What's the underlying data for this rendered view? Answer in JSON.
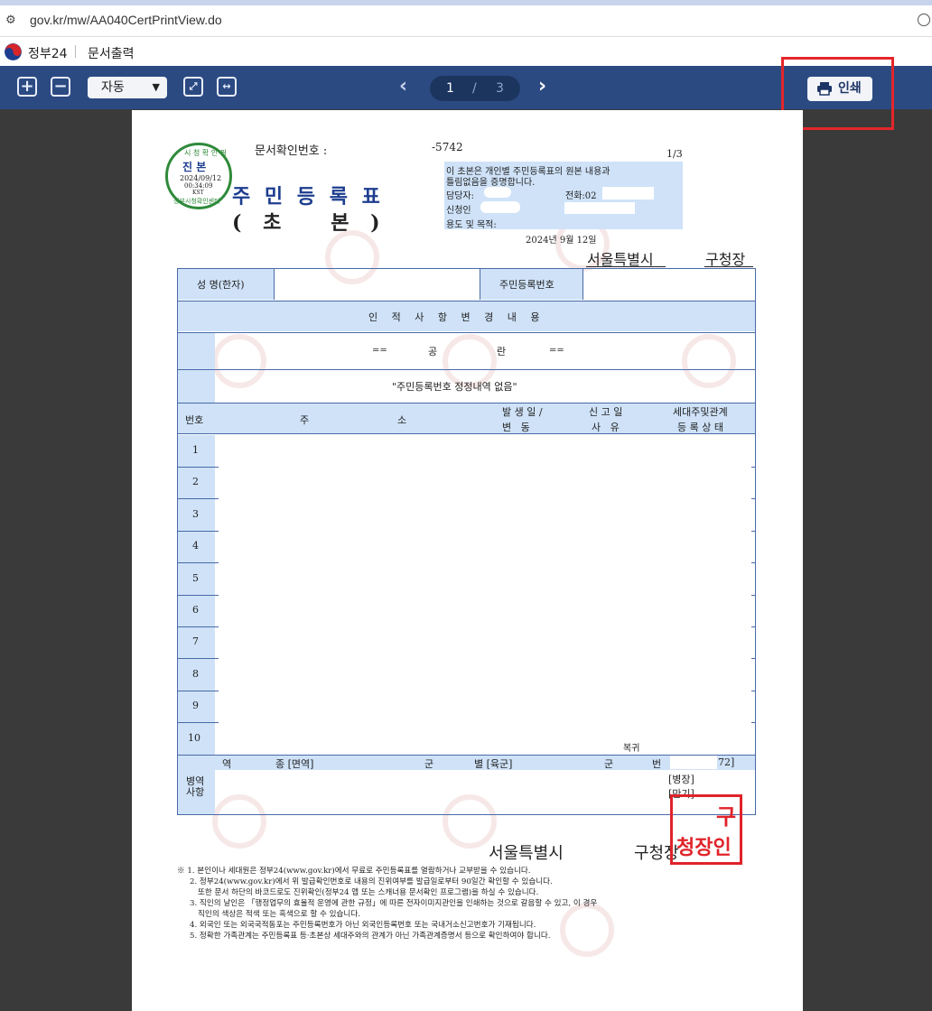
{
  "browser": {
    "url": "gov.kr/mw/AA040CertPrintView.do"
  },
  "app": {
    "brand": "정부24",
    "title": "문서출력"
  },
  "toolbar": {
    "zoom_mode": "자동",
    "current_page": "1",
    "page_separator": "/",
    "total_pages": "3",
    "print_label": "인쇄"
  },
  "stamp_round": {
    "top_text": "시 청 확 인 필",
    "main": "진 본",
    "date": "2024/09/12",
    "time": "00:34:09",
    "tz": "KST",
    "bottom_text": "정부시청확인센터"
  },
  "document": {
    "confirm_label": "문서확인번호 :",
    "confirm_number": "-5742",
    "page_indicator": "1/3",
    "title_line1": "주 민 등 록 표",
    "title_line2": "( 초   본 )",
    "notice_line1": "이 초본은 개인별 주민등록표의 원본 내용과",
    "notice_line2": "틀림없음을 증명합니다.",
    "manager_label": "담당자:",
    "phone_label": "전화:02",
    "applicant_label": "신청인",
    "purpose_label": "용도 및 목적:",
    "issue_date": "2024년 9월 12일",
    "issuer_city": "서울특별시",
    "issuer_office": "구청장",
    "name_label": "성 명(한자)",
    "rrn_label": "주민등록번호",
    "personal_section": "인 적 사 항 변 경 내 용",
    "blank_mark_left": "==",
    "blank_word1": "공",
    "blank_word2": "란",
    "blank_mark_right": "==",
    "correction_note": "\"주민등록번호 정정내역 없음\"",
    "col_no": "번호",
    "col_addr1": "주",
    "col_addr2": "소",
    "col_occur": "발 생 일 /",
    "col_change": "변   동",
    "col_report": "신 고 일",
    "col_reason": "사   유",
    "col_household": "세대주및관계",
    "col_status": "등 록 상 태",
    "rows": [
      "1",
      "2",
      "3",
      "4",
      "5",
      "6",
      "7",
      "8",
      "9",
      "10"
    ],
    "reinstate": "복귀",
    "military_label1": "병역",
    "military_label2": "사항",
    "mil_type_label": "역",
    "mil_kind": "종 [면역]",
    "mil_branch_label": "군",
    "mil_branch": "별 [육군]",
    "mil_number_label": "군",
    "mil_number_label2": "번",
    "mil_number_tail": "72]",
    "mil_rank": "[병장]",
    "mil_end": "[만기]",
    "footer_city": "서울특별시",
    "footer_office": "구청장",
    "seal_text1": "구",
    "seal_text2": "청장인",
    "notes": [
      "※ 1. 본인이나 세대원은 정부24(www.gov.kr)에서 무료로 주민등록표를 열람하거나 교부받을 수 있습니다.",
      "2. 정부24(www.gov.kr)에서 위 발급확인번호로 내용의 진위여부를 발급일로부터 90일간 확인할 수 있습니다.",
      "또한 문서 하단의 바코드로도 진위확인(정부24 앱 또는 스캐너용 문서확인 프로그램)을 하실 수 있습니다.",
      "3. 직인의 날인은 「행정업무의 효율적 운영에 관한 규정」에 따른 전자이미지관인을 인쇄하는 것으로 갈음할 수 있고, 이 경우",
      "직인의 색상은 적색 또는 흑색으로 할 수 있습니다.",
      "4. 외국인 또는 외국국적동포는 주민등록번호가 아닌 외국인등록번호 또는 국내거소신고번호가 기재됩니다.",
      "5. 정확한 가족관계는 주민등록표 등·초본상 세대주와의 관계가 아닌 가족관계증명서 등으로 확인하여야 합니다."
    ]
  },
  "icons": {
    "site": "site-settings-icon",
    "zoom_in": "zoom-in-icon",
    "zoom_out": "zoom-out-icon",
    "fit_page": "fit-page-icon",
    "fit_width": "fit-width-icon",
    "prev": "chevron-left-icon",
    "next": "chevron-right-icon",
    "print": "printer-icon"
  },
  "colors": {
    "toolbar": "#2c4a82",
    "table_header": "#cfe2f8",
    "highlight": "#e4262b",
    "seal": "#e0232a",
    "stamp": "#2f8a3a"
  }
}
